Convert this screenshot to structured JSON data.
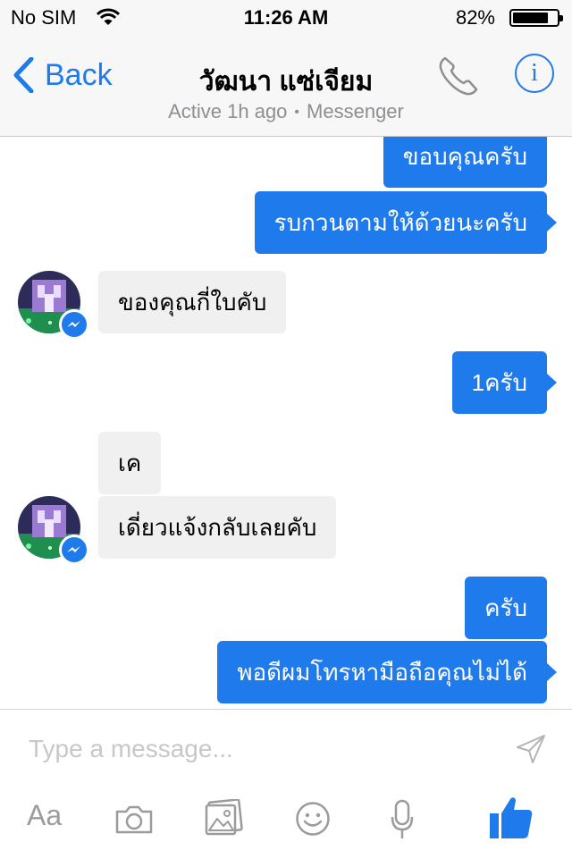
{
  "status_bar": {
    "carrier": "No SIM",
    "time": "11:26 AM",
    "battery_text": "82%",
    "battery_level": 0.82
  },
  "nav": {
    "back_label": "Back",
    "title": "วัฒนา แซ่เจียม",
    "status": "Active 1h ago",
    "separator": "•",
    "app": "Messenger"
  },
  "messages": [
    {
      "direction": "out",
      "text": "ขอบคุณครับ"
    },
    {
      "direction": "out",
      "text": "รบกวนตามให้ด้วยนะครับ"
    },
    {
      "direction": "in",
      "text": "ของคุณกี่ใบคับ"
    },
    {
      "direction": "out",
      "text": "1ครับ"
    },
    {
      "direction": "in",
      "text": "เค"
    },
    {
      "direction": "in",
      "text": "เดี่ยวแจ้งกลับเลยคับ"
    },
    {
      "direction": "out",
      "text": "ครับ"
    },
    {
      "direction": "out",
      "text": "พอดีผมโทรหามือถือคุณไม่ได้"
    }
  ],
  "composer": {
    "placeholder": "Type a message...",
    "text_format_label": "Aa"
  },
  "icons": {
    "phone": "phone-icon",
    "info": "info-icon",
    "send": "send-icon",
    "camera": "camera-icon",
    "gallery": "gallery-icon",
    "emoji": "emoji-icon",
    "microphone": "microphone-icon",
    "like": "thumbs-up-icon",
    "messenger_badge": "messenger-badge-icon"
  },
  "colors": {
    "accent": "#1f7aec",
    "incoming_bubble": "#f1f0f0",
    "bar_background": "#f7f7f7",
    "secondary_text": "#8e8e93"
  }
}
